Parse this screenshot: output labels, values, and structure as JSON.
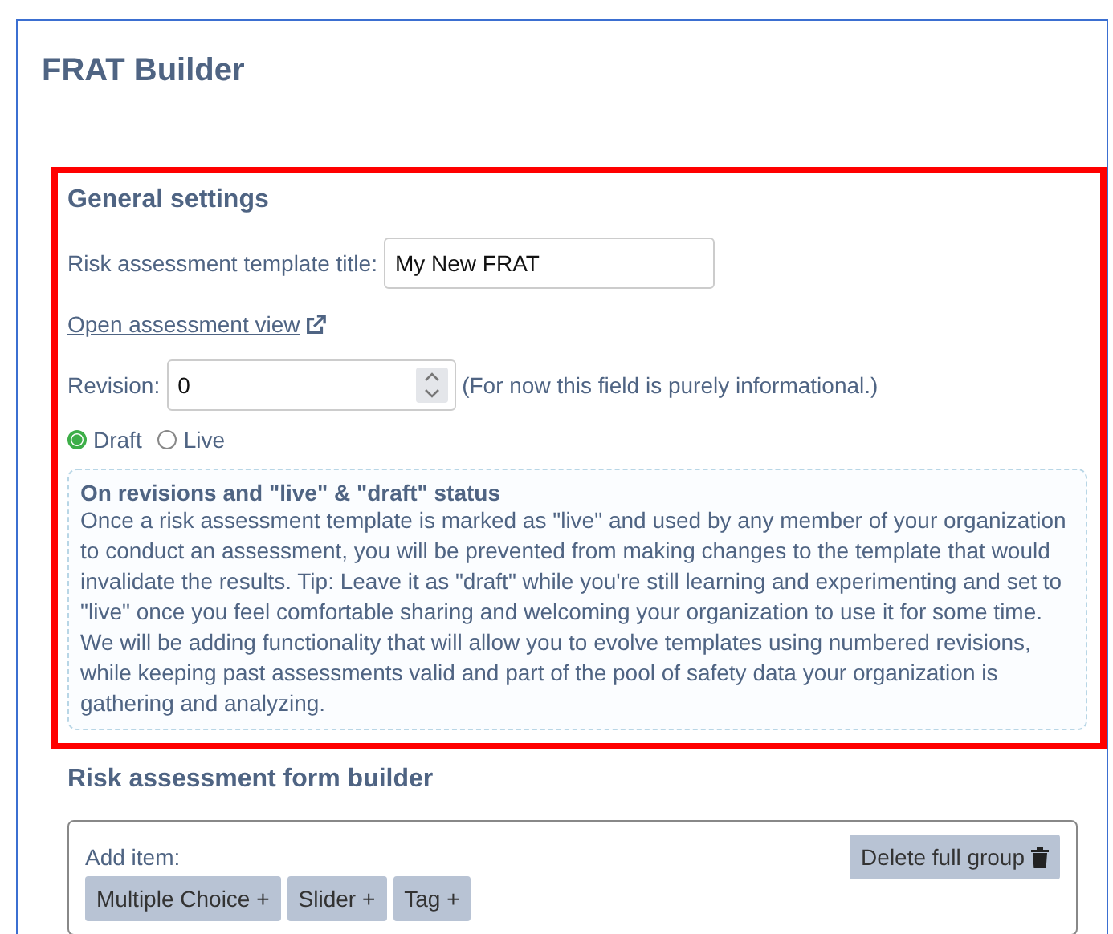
{
  "page_title": "FRAT Builder",
  "general_settings": {
    "heading": "General settings",
    "template_title": {
      "label": "Risk assessment template title:",
      "value": "My New FRAT"
    },
    "open_link": "Open assessment view",
    "revision": {
      "label": "Revision:",
      "value": "0",
      "note": "(For now this field is purely informational.)"
    },
    "status_options": [
      {
        "label": "Draft",
        "selected": true
      },
      {
        "label": "Live",
        "selected": false
      }
    ],
    "info": {
      "heading": "On revisions and \"live\" & \"draft\" status",
      "paragraphs": [
        "Once a risk assessment template is marked as \"live\" and used by any member of your organization to conduct an assessment, you will be prevented from making changes to the template that would invalidate the results. Tip: Leave it as \"draft\" while you're still learning and experimenting and set to \"live\" once you feel comfortable sharing and welcoming your organization to use it for some time.",
        "We will be adding functionality that will allow you to evolve templates using numbered revisions, while keeping past assessments valid and part of the pool of safety data your organization is gathering and analyzing."
      ]
    }
  },
  "form_builder": {
    "heading": "Risk assessment form builder",
    "add_item_label": "Add item:",
    "add_buttons": [
      "Multiple Choice +",
      "Slider +",
      "Tag +"
    ],
    "delete_button": "Delete full group"
  }
}
